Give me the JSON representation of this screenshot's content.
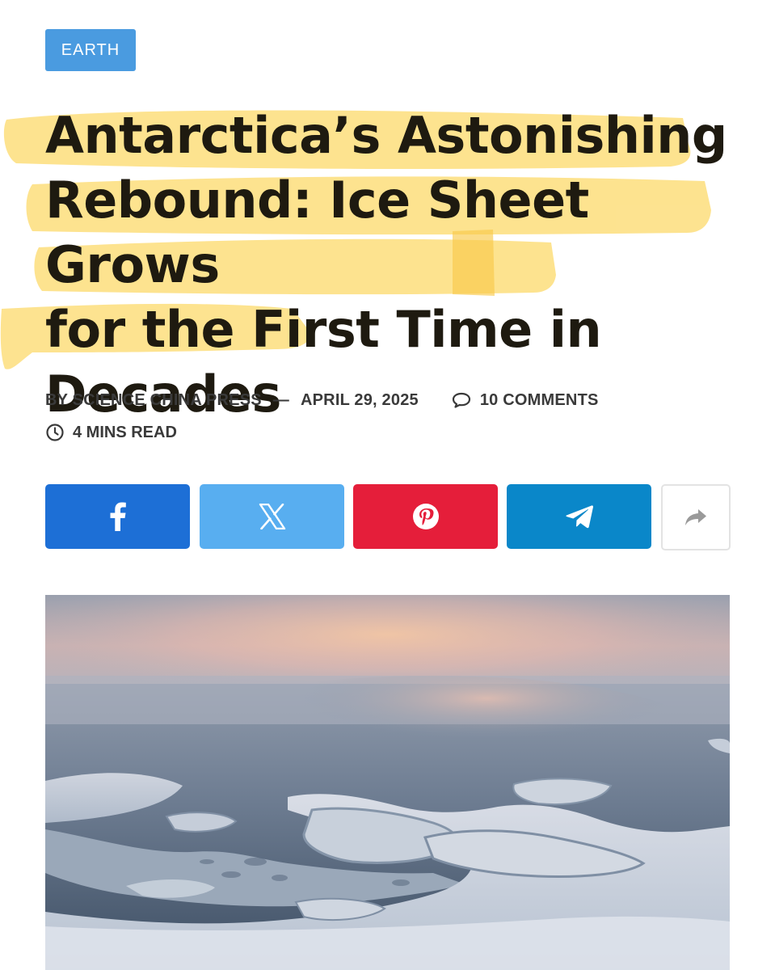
{
  "category": {
    "label": "EARTH"
  },
  "article": {
    "title_lines": [
      "Antarctica’s Astonishing",
      "Rebound: Ice Sheet Grows",
      "for the First Time in",
      "Decades"
    ],
    "byline": "BY SCIENCE CHINA PRESS",
    "separator": "—",
    "date": "APRIL 29, 2025",
    "comments": "10 COMMENTS",
    "read_time": "4 MINS READ"
  },
  "share": [
    {
      "network": "facebook",
      "icon": "facebook-icon",
      "color": "#1d6fd6"
    },
    {
      "network": "x",
      "icon": "x-icon",
      "color": "#58aef0"
    },
    {
      "network": "pinterest",
      "icon": "pinterest-icon",
      "color": "#e51e3a"
    },
    {
      "network": "telegram",
      "icon": "telegram-icon",
      "color": "#0a87c9"
    },
    {
      "network": "more",
      "icon": "share-arrow-icon",
      "color": "#ffffff"
    }
  ],
  "colors": {
    "category": "#4a9be0",
    "highlight": "#fde28a",
    "title": "#1e1a10",
    "meta": "#3a3a3a"
  }
}
